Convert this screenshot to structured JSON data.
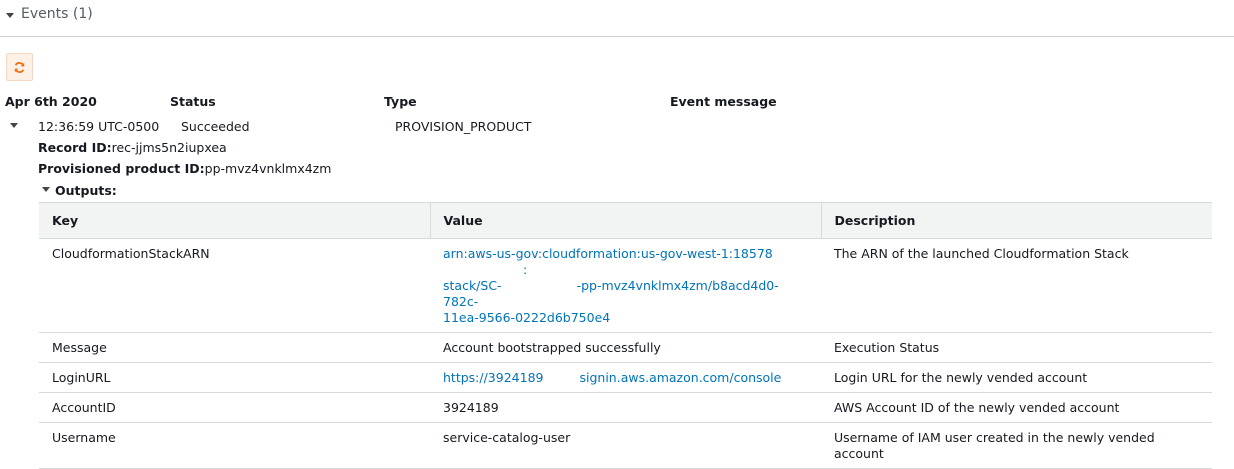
{
  "section": {
    "title": "Events (1)"
  },
  "events": {
    "date": "Apr 6th 2020",
    "columns": {
      "status": "Status",
      "type": "Type",
      "message": "Event message"
    },
    "row": {
      "time": "12:36:59 UTC-0500",
      "status": "Succeeded",
      "type": "PROVISION_PRODUCT",
      "record_label": "Record ID:",
      "record_value": "rec-jjms5n2iupxea",
      "product_label": "Provisioned product ID:",
      "product_value": "pp-mvz4vnklmx4zm",
      "outputs_label": "Outputs:"
    }
  },
  "outputs": {
    "headers": {
      "key": "Key",
      "value": "Value",
      "description": "Description"
    },
    "rows": [
      {
        "key": "CloudformationStackARN",
        "value_lines": [
          "arn:aws-us-gov:cloudformation:us-gov-west-1:18578",
          "stack/SC-",
          "-pp-mvz4vnklmx4zm/b8acd4d0-782c-",
          "11ea-9566-0222d6b750e4"
        ],
        "value_sep": ":",
        "description": "The ARN of the launched Cloudformation Stack"
      },
      {
        "key": "Message",
        "value": "Account bootstrapped successfully",
        "description": "Execution Status"
      },
      {
        "key": "LoginURL",
        "value_a": "https://3924189",
        "value_b": "signin.aws.amazon.com/console",
        "description": "Login URL for the newly vended account"
      },
      {
        "key": "AccountID",
        "value": "3924189",
        "description": "AWS Account ID of the newly vended account"
      },
      {
        "key": "Username",
        "value": "service-catalog-user",
        "description": "Username of IAM user created in the newly vended account"
      }
    ]
  },
  "icons": {
    "section_toggle": "caret-down-icon",
    "refresh": "refresh-icon",
    "row_toggle": "caret-down-icon",
    "outputs_toggle": "caret-down-icon"
  },
  "colors": {
    "link": "#0073bb",
    "refresh_accent": "#ec7211",
    "header_bg": "#f2f3f3"
  }
}
